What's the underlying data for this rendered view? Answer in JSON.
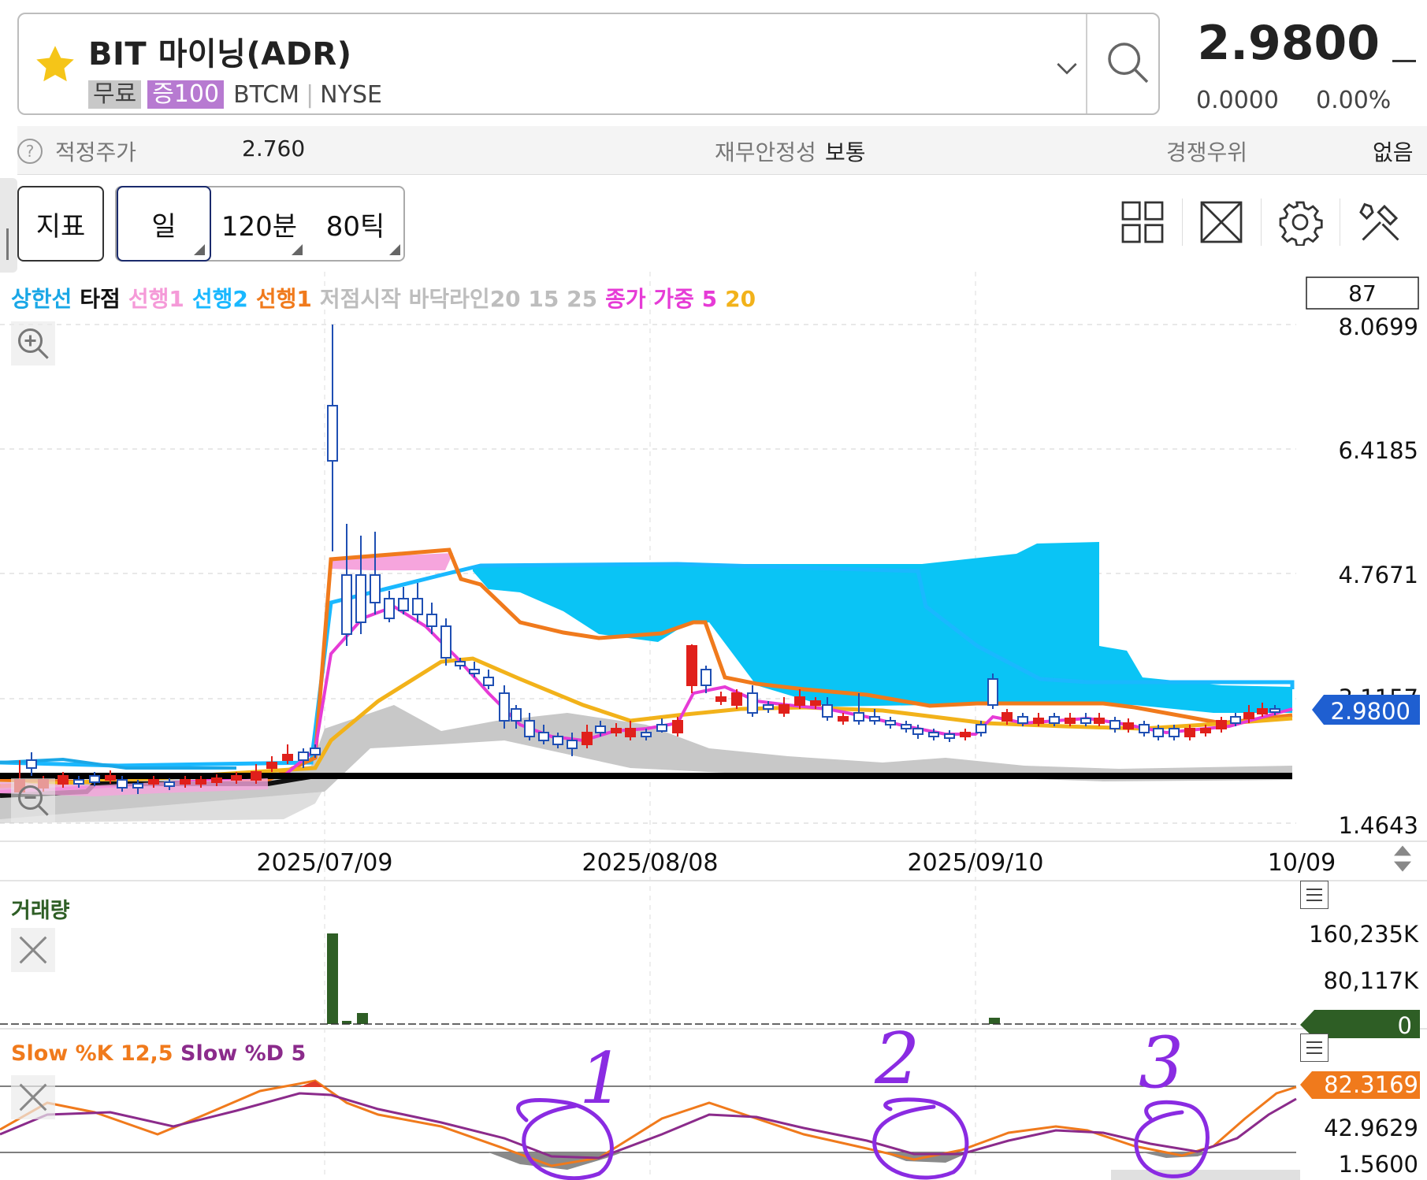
{
  "header": {
    "stock_name": "BIT 마이닝(ADR)",
    "tag_free": "무료",
    "tag_margin": "증100",
    "code": "BTCM",
    "market": "NYSE",
    "price": "2.9800",
    "change": "0.0000",
    "change_pct": "0.00%"
  },
  "info_bar": {
    "fair_price_label": "적정주가",
    "fair_price_value": "2.760",
    "stability_label": "재무안정성",
    "stability_value": "보통",
    "competitive_label": "경쟁우위",
    "competitive_value": "없음"
  },
  "toolbar": {
    "indicator_label": "지표",
    "period_day": "일",
    "period_120": "120분",
    "period_80tick": "80틱"
  },
  "legend": [
    {
      "text": "상한선",
      "color": "#1aa7e6"
    },
    {
      "text": "타점",
      "color": "#111111"
    },
    {
      "text": "선행1",
      "color": "#f59ad8"
    },
    {
      "text": "선행2",
      "color": "#1ab8ff"
    },
    {
      "text": "선행1",
      "color": "#f07a1c"
    },
    {
      "text": "저점시작 바닥라인20 15 25",
      "color": "#bdbdbd"
    },
    {
      "text": "종가 가중 5",
      "color": "#e63bd6"
    },
    {
      "text": "20",
      "color": "#f2b21a"
    }
  ],
  "price_axis": {
    "top_box": "87",
    "labels": [
      "8.0699",
      "6.4185",
      "4.7671",
      "1.4643"
    ],
    "hidden_label": "3.1157",
    "current_tag": "2.9800",
    "current_color": "#1f5fd1"
  },
  "date_axis": [
    "2025/07/09",
    "2025/08/08",
    "2025/09/10",
    "10/09"
  ],
  "volume": {
    "title": "거래량",
    "labels": [
      "160,235K",
      "80,117K"
    ],
    "current": "0",
    "bar_color": "#2e5e25"
  },
  "stochastic": {
    "title_k": "Slow %K 12,5",
    "title_d": "Slow %D 5",
    "k_color": "#f07a1c",
    "d_color": "#8b2b8b",
    "current_tag": "82.3169",
    "labels": [
      "42.9629",
      "1.5600"
    ]
  },
  "annotations": [
    "1",
    "2",
    "3"
  ],
  "annotation_color": "#8a2be2"
}
